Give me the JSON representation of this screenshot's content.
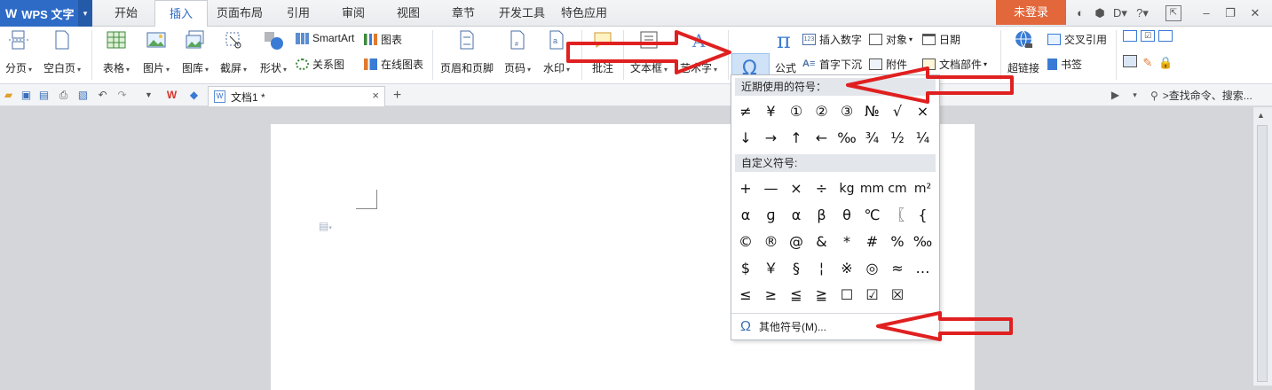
{
  "app": {
    "name": "WPS 文字"
  },
  "tabs": [
    "开始",
    "插入",
    "页面布局",
    "引用",
    "审阅",
    "视图",
    "章节",
    "开发工具",
    "特色应用"
  ],
  "active_tab": "插入",
  "login_label": "未登录",
  "ribbon": {
    "large": [
      {
        "label": "分页",
        "dd": true
      },
      {
        "label": "空白页",
        "dd": true
      },
      {
        "label": "表格",
        "dd": true
      },
      {
        "label": "图片",
        "dd": true
      },
      {
        "label": "图库",
        "dd": true
      },
      {
        "label": "截屏",
        "dd": true
      },
      {
        "label": "形状",
        "dd": true
      },
      {
        "label": "页眉和页脚",
        "dd": false
      },
      {
        "label": "页码",
        "dd": true
      },
      {
        "label": "水印",
        "dd": true
      },
      {
        "label": "批注",
        "dd": false
      },
      {
        "label": "文本框",
        "dd": true
      },
      {
        "label": "艺术字",
        "dd": true
      },
      {
        "label": "符号",
        "dd": true
      },
      {
        "label": "公式",
        "dd": false
      },
      {
        "label": "超链接",
        "dd": false
      }
    ],
    "small": {
      "smartart": "SmartArt",
      "relation": "关系图",
      "chart": "图表",
      "online_chart": "在线图表",
      "insert_number": "插入数字",
      "object": "对象",
      "date": "日期",
      "drop_cap": "首字下沉",
      "attachment": "附件",
      "doc_parts": "文档部件",
      "cross_ref": "交叉引用",
      "bookmark": "书签"
    }
  },
  "document": {
    "tab_title": "文档1 *"
  },
  "search": {
    "label": ">查找命令、搜索..."
  },
  "symbol_menu": {
    "recent_header": "近期使用的符号：",
    "recent": [
      "≠",
      "¥",
      "①",
      "②",
      "③",
      "№",
      "√",
      "×",
      "↓",
      "→",
      "↑",
      "←",
      "‰",
      "¾",
      "½",
      "¼"
    ],
    "custom_header": "自定义符号:",
    "custom": [
      "+",
      "—",
      "×",
      "÷",
      "kg",
      "mm",
      "cm",
      "m²",
      "α",
      "ɡ",
      "α",
      "β",
      "θ",
      "℃",
      "〖",
      "{",
      "©",
      "®",
      "@",
      "&",
      "*",
      "#",
      "%",
      "‰",
      "$",
      "￥",
      "§",
      "¦",
      "※",
      "◎",
      "≈",
      "…",
      "≤",
      "≥",
      "≦",
      "≧",
      "☐",
      "☑",
      "☒"
    ],
    "more_label": "其他符号(M)..."
  },
  "colors": {
    "accent": "#2e6bc6",
    "login": "#e2673b",
    "arrow": "#e02020"
  }
}
